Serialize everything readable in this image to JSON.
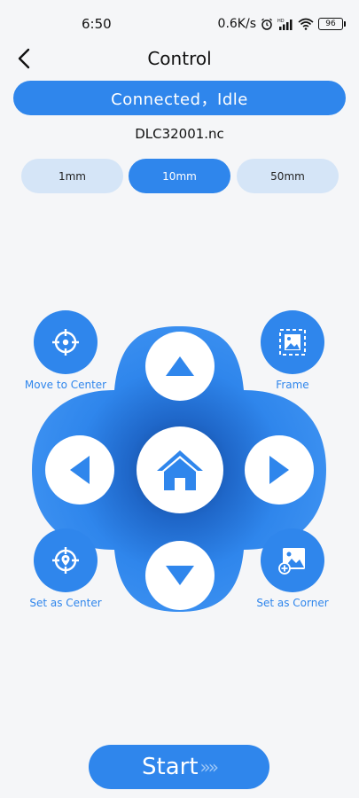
{
  "status_bar": {
    "time": "6:50",
    "net_speed": "0.6K/s",
    "battery": "96",
    "icons": [
      "alarm-icon",
      "signal-icon",
      "wifi-icon",
      "battery-icon"
    ]
  },
  "header": {
    "title": "Control",
    "back_icon": "chevron-left-icon"
  },
  "connection": {
    "status": "Connected，Idle"
  },
  "file": {
    "name": "DLC32001.nc"
  },
  "steps": {
    "options": [
      "1mm",
      "10mm",
      "50mm"
    ],
    "selected": "10mm"
  },
  "actions": {
    "move_to_center": "Move to Center",
    "frame": "Frame",
    "set_as_center": "Set as Center",
    "set_as_corner": "Set as Corner"
  },
  "start": {
    "label": "Start",
    "arrows": "»»"
  },
  "colors": {
    "accent": "#2f86ec",
    "light_accent": "#d5e5f7",
    "background": "#f5f6f8"
  }
}
